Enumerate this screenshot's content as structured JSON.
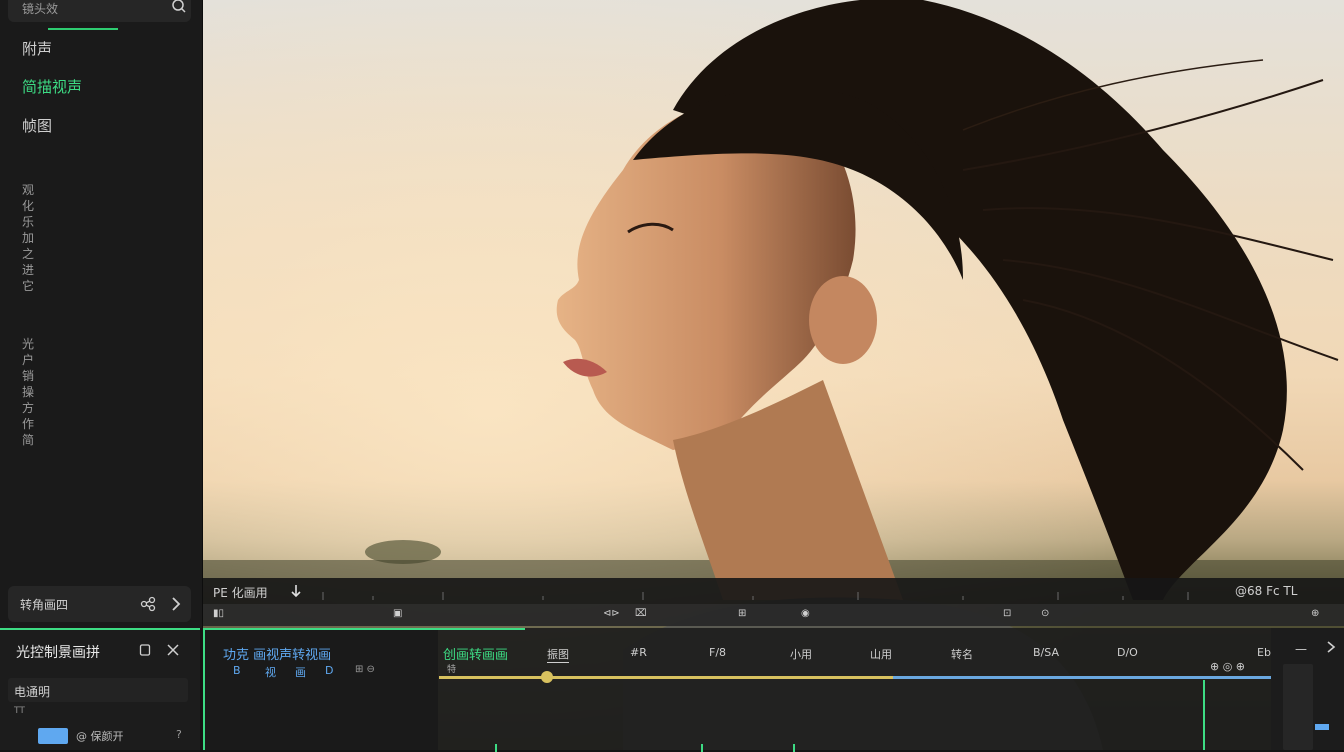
{
  "sidebar": {
    "search_text": "镜头效",
    "items": [
      {
        "label": "附声"
      },
      {
        "label": "简描视声"
      },
      {
        "label": "帧图"
      }
    ],
    "vertical_text_1": "观化乐加之进它",
    "vertical_text_2": "光户销操方作简",
    "footer_label": "转角画四"
  },
  "ruler": {
    "label": "PE 化画用",
    "right_label": "@68 Fc TL"
  },
  "props_panel": {
    "title": "光控制景画拼",
    "row_label": "电通明",
    "small_text": "TT",
    "value": "@ 保颜开",
    "question": "?"
  },
  "timeline": {
    "track_title": "功克 画视声转视画",
    "track_tools": [
      "B",
      "视",
      "画",
      "D"
    ],
    "track_tools_right": "⊞  ⊖",
    "keyframe_title": "创画转画画",
    "keyframe_sub": "特",
    "columns": [
      "振图",
      "#R",
      "F/8",
      "小用",
      "山用",
      "转名",
      "B/SA",
      "D/O"
    ],
    "end_icon": "Eb",
    "right_icons": "⊕  ◎  ⊕"
  },
  "side_panel": {
    "dash": "—"
  },
  "colors": {
    "accent": "#3ddc84",
    "blue": "#5fa8f0",
    "yellow": "#d8c15f"
  },
  "progress": {
    "knob_fraction": 0.1,
    "yellow_fraction": 0.54
  }
}
